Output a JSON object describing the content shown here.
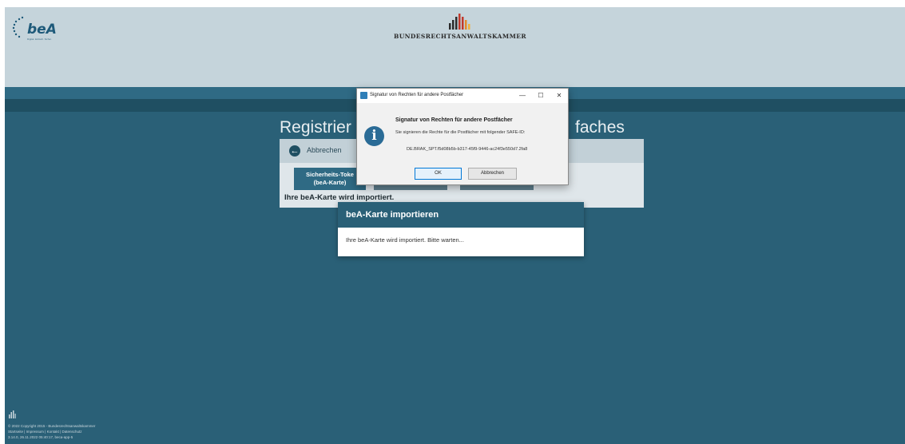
{
  "header": {
    "logo_text": "beA",
    "logo_sub": "Digital. Einfach. Sicher.",
    "org_name": "BUNDESRECHTSANWALTSKAMMER"
  },
  "page": {
    "title_left": "Registrier",
    "title_right": "faches",
    "back_label": "Abbrechen",
    "tab_active_line1": "Sicherheits-Toke",
    "tab_active_line2": "(beA-Karte)",
    "status_message": "Ihre beA-Karte wird importiert."
  },
  "import_dialog": {
    "title": "beA-Karte importieren",
    "message": "Ihre beA-Karte wird importiert. Bitte warten..."
  },
  "windows_dialog": {
    "title": "Signatur von Rechten für andere Postfächer",
    "heading": "Signatur von Rechten für andere Postfächer",
    "text": "Sie signieren die Rechte für die Postfächer mit folgender SAFE-ID:",
    "safe_id": "DE.BRAK_SPT.f5d08b5b-b317-45f9-9446-ac24f3e550d7.2fa8",
    "ok_label": "OK",
    "cancel_label": "Abbrechen",
    "minimize_glyph": "—",
    "maximize_glyph": "☐",
    "close_glyph": "✕",
    "info_glyph": "i"
  },
  "footer": {
    "copyright": "© 2022 Copyright 2015 - Bundesrechtsanwaltskammer",
    "links": "Startseite | Impressum | Kontakt | Datenschutz",
    "version": "3.14.0, 26.11.2022 05:40:17, beca-app-5"
  },
  "colors": {
    "background": "#2a6077",
    "header": "#c5d4db",
    "nav_dark": "#1f4f62",
    "brand_blue": "#1e5a7a",
    "accent_orange": "#e38a2c",
    "accent_red": "#c0392b"
  }
}
